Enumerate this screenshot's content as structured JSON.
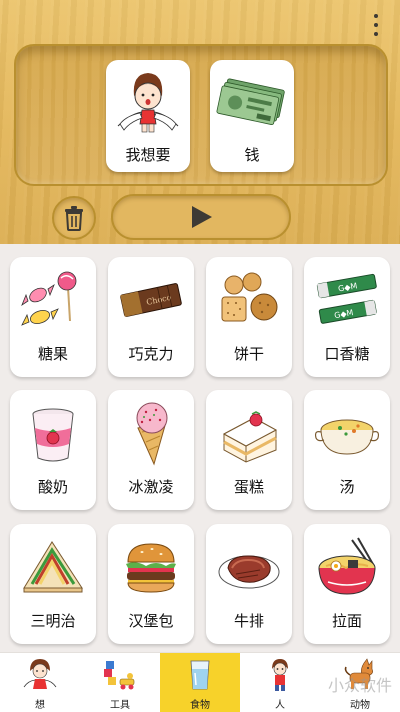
{
  "sentence": {
    "cards": [
      {
        "label": "我想要",
        "icon": "girl-arms-open-icon"
      },
      {
        "label": "钱",
        "icon": "money-banknotes-icon"
      }
    ],
    "trash_icon": "trash-icon",
    "play_icon": "play-icon"
  },
  "items": [
    {
      "label": "糖果",
      "icon": "candy-icon"
    },
    {
      "label": "巧克力",
      "icon": "chocolate-icon"
    },
    {
      "label": "饼干",
      "icon": "cookies-icon"
    },
    {
      "label": "口香糖",
      "icon": "chewing-gum-icon"
    },
    {
      "label": "酸奶",
      "icon": "yogurt-icon"
    },
    {
      "label": "冰激凌",
      "icon": "ice-cream-icon"
    },
    {
      "label": "蛋糕",
      "icon": "cake-icon"
    },
    {
      "label": "汤",
      "icon": "soup-icon"
    },
    {
      "label": "三明治",
      "icon": "sandwich-icon"
    },
    {
      "label": "汉堡包",
      "icon": "hamburger-icon"
    },
    {
      "label": "牛排",
      "icon": "steak-icon"
    },
    {
      "label": "拉面",
      "icon": "ramen-icon"
    }
  ],
  "tabs": [
    {
      "label": "想",
      "icon": "girl-icon",
      "active": false
    },
    {
      "label": "工具",
      "icon": "toys-icon",
      "active": false
    },
    {
      "label": "食物",
      "icon": "glass-of-water-icon",
      "active": true
    },
    {
      "label": "人",
      "icon": "person-icon",
      "active": false
    },
    {
      "label": "动物",
      "icon": "dog-icon",
      "active": false
    }
  ],
  "watermark": "小众软件",
  "colors": {
    "wood": "#e3b65a",
    "active_tab": "#f7d22a",
    "card": "#ffffff",
    "background": "#f0ecea"
  }
}
